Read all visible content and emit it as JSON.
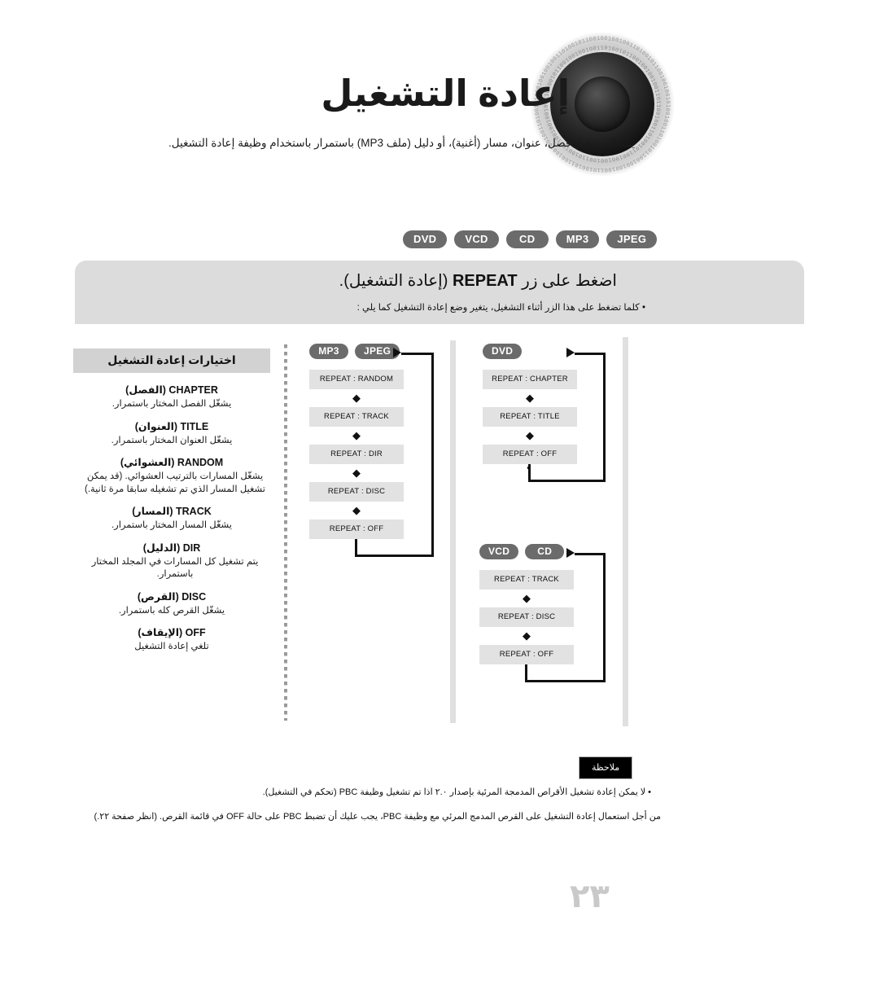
{
  "header": {
    "title": "إعادة التشغيل",
    "intro": "يمكنك تشغيل فصل، عنوان، مسار (أغنية)، أو دليل (ملف MP3) باستمرار باستخدام وظيفة إعادة التشغيل.",
    "speaker_icon": "speaker-cone-icon"
  },
  "media_badges": [
    "DVD",
    "VCD",
    "CD",
    "MP3",
    "JPEG"
  ],
  "instruction_panel": {
    "title_prefix": "اضغط على زر ",
    "title_keyword": "REPEAT",
    "title_suffix": " (إعادة التشغيل).",
    "bullet": "• كلما تضغط على هذا الزر أثناء التشغيل، يتغير وضع إعادة التشغيل كما يلي :"
  },
  "options": {
    "title": "اختيارات إعادة التشغيل",
    "items": [
      {
        "name": "CHAPTER",
        "arabic": "(الفصل)",
        "desc": "يشغّل الفصل المختار باستمرار."
      },
      {
        "name": "TITLE",
        "arabic": "(العنوان)",
        "desc": "يشغّل العنوان المختار باستمرار."
      },
      {
        "name": "RANDOM",
        "arabic": "(العشوائي)",
        "desc": "يشغّل المسارات بالترتيب العشوائي. (قد يمكن تشغيل المسار الذي تم تشغيله سابقا مرة ثانية.)"
      },
      {
        "name": "TRACK",
        "arabic": "(المسار)",
        "desc": "يشغّل المسار المختار باستمرار."
      },
      {
        "name": "DIR",
        "arabic": "(الدليل)",
        "desc": "يتم تشغيل كل المسارات في المجلد المختار باستمرار."
      },
      {
        "name": "DISC",
        "arabic": "(القرص)",
        "desc": "يشغّل القرص كله باستمرار."
      },
      {
        "name": "OFF",
        "arabic": "(الإيقاف)",
        "desc": "تلغي إعادة التشغيل"
      }
    ]
  },
  "flows": [
    {
      "id": "mp3-jpeg",
      "badges": [
        "MP3",
        "JPEG"
      ],
      "steps": [
        "REPEAT : RANDOM",
        "REPEAT : TRACK",
        "REPEAT : DIR",
        "REPEAT : DISC",
        "REPEAT : OFF"
      ],
      "arrow_glyph": "◆"
    },
    {
      "id": "dvd",
      "badges": [
        "DVD"
      ],
      "steps": [
        "REPEAT : CHAPTER",
        "REPEAT : TITLE",
        "REPEAT : OFF"
      ],
      "arrow_glyph": "◆"
    },
    {
      "id": "vcd-cd",
      "badges": [
        "VCD",
        "CD"
      ],
      "steps": [
        "REPEAT : TRACK",
        "REPEAT : DISC",
        "REPEAT : OFF"
      ],
      "arrow_glyph": "◆"
    }
  ],
  "notes": {
    "badge": "ملاحظة",
    "lines": [
      "• لا يمكن إعادة تشغيل الأقراص المدمجة المرئية بإصدار ٢.٠ اذا تم تشغيل وظيفة PBC (تحكم في التشغيل).",
      "من أجل استعمال إعادة التشغيل على القرص المدمج المرئي مع وظيفة PBC، يجب عليك أن تضبط PBC على حالة OFF في قائمة القرص. (انظر صفحة ٢٢.)"
    ]
  },
  "page_number": "٢٣",
  "colors": {
    "badge_gray": "#6b6b6b",
    "panel_gray": "#dcdcdc",
    "box_gray": "#e2e2e2",
    "divider_gray": "#e0e0e0",
    "page_number_gray": "#c9c9c9"
  }
}
